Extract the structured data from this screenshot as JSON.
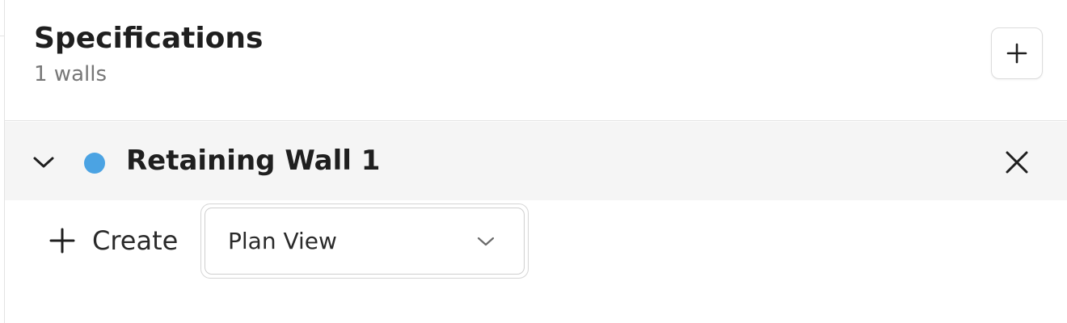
{
  "header": {
    "title": "Specifications",
    "subtitle": "1 walls",
    "add_icon": "plus-icon"
  },
  "walls": [
    {
      "name": "Retaining Wall 1",
      "color": "#4ba3e3",
      "expanded": true,
      "toggle_icon": "chevron-down-icon",
      "remove_icon": "close-icon",
      "create": {
        "label": "Create",
        "icon": "plus-icon",
        "view_select": {
          "selected": "Plan View",
          "icon": "chevron-down-icon"
        }
      }
    }
  ]
}
